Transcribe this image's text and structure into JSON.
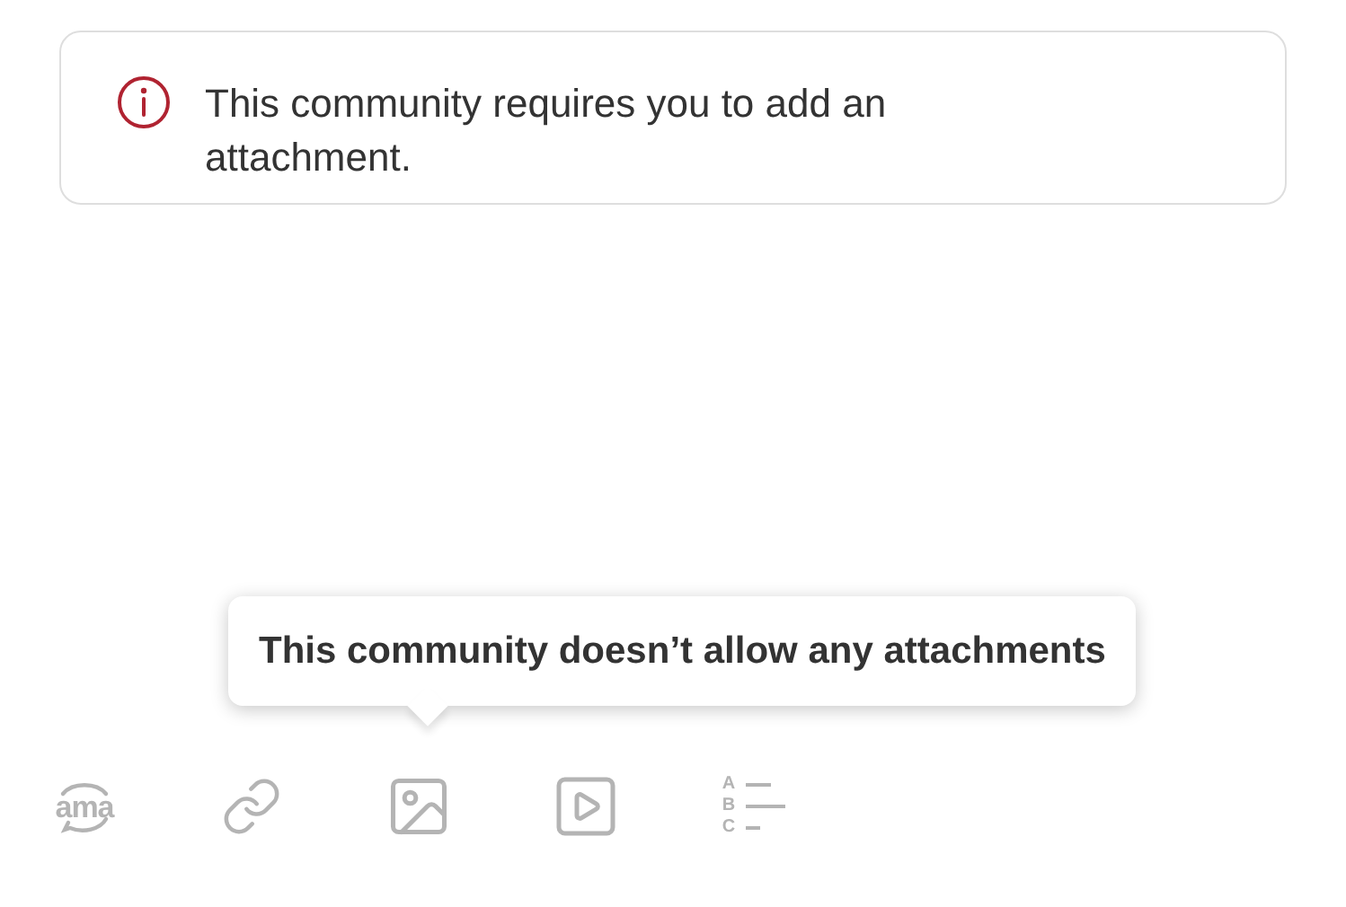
{
  "alert": {
    "text": "This community requires you to add an attachment."
  },
  "tooltip": {
    "text": "This community doesn’t allow any attachments"
  },
  "toolbar": [
    {
      "kind": "ama",
      "label": "ama"
    },
    {
      "kind": "link"
    },
    {
      "kind": "image"
    },
    {
      "kind": "video"
    },
    {
      "kind": "poll",
      "letters": [
        "A",
        "B",
        "C"
      ]
    }
  ]
}
